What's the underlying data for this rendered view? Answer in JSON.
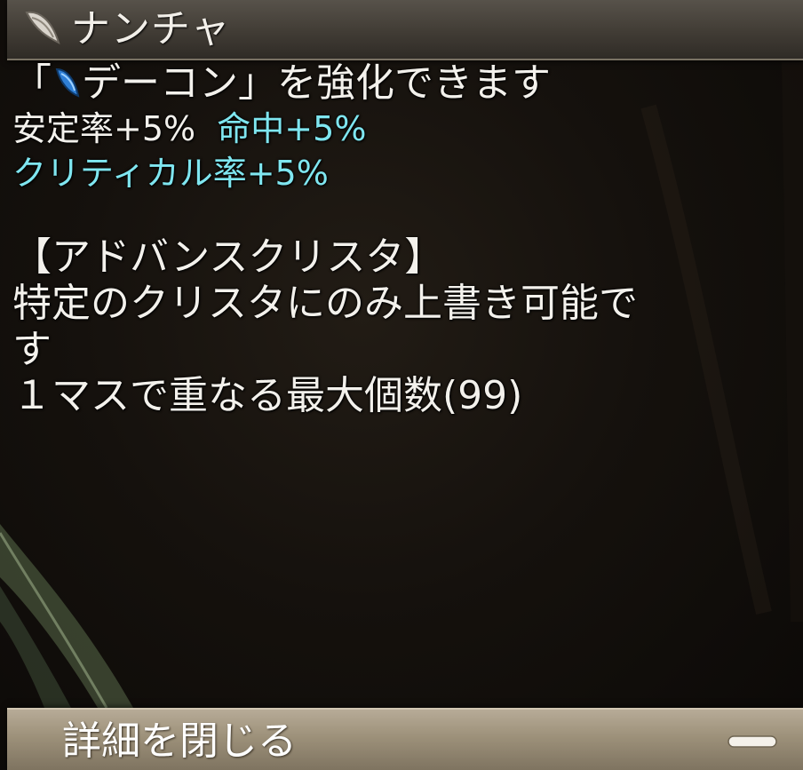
{
  "title": {
    "item_name": "ナンチャ",
    "icon": "crysta-shard-icon"
  },
  "description": {
    "line1_open": "「",
    "line1_icon": "blue-crysta-icon",
    "line1_target": "デーコン",
    "line1_close": "」を強化できます",
    "stat1": "安定率+5%",
    "stat2": "命中+5%",
    "stat3": "クリティカル率+5%",
    "section_header": "【アドバンスクリスタ】",
    "section_line1": "特定のクリスタにのみ上書き可能で",
    "section_line2": "す",
    "stack_line": "１マスで重なる最大個数(99)"
  },
  "bottom": {
    "close_label": "詳細を閉じる",
    "close_icon": "minus-icon"
  },
  "colors": {
    "text": "#f3f1ec",
    "stat_cyan": "#7fe6f0",
    "title_bar": "#4a453e",
    "bottom_bar": "#9c9079"
  }
}
